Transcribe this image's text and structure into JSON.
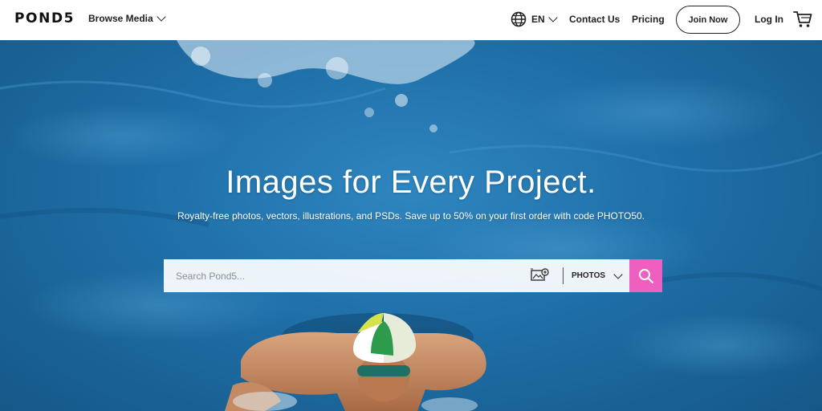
{
  "header": {
    "logo": "POND5",
    "browse_label": "Browse Media",
    "language": "EN",
    "contact_label": "Contact Us",
    "pricing_label": "Pricing",
    "join_label": "Join Now",
    "login_label": "Log In"
  },
  "hero": {
    "headline": "Images for Every Project.",
    "subhead": "Royalty-free photos, vectors, illustrations, and PSDs. Save up to 50% on your first order with code PHOTO50."
  },
  "search": {
    "placeholder": "Search Pond5...",
    "value": "",
    "media_type": "PHOTOS"
  },
  "colors": {
    "accent": "#ee5fc0",
    "water": "#1f6fa8",
    "text_dark": "#222222"
  },
  "icons": {
    "language": "globe-icon",
    "browse": "chevron-down-icon",
    "cart": "cart-icon",
    "visual_search": "image-search-icon",
    "search": "search-icon"
  }
}
